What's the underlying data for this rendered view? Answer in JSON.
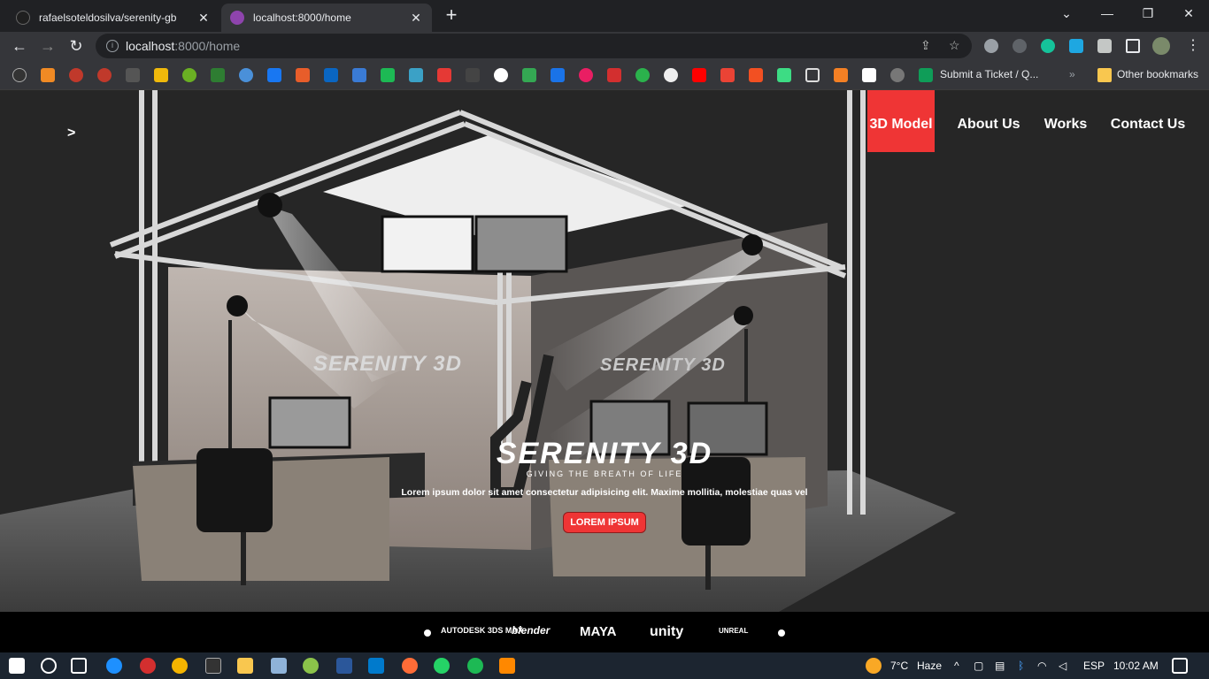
{
  "browser": {
    "tabs": [
      {
        "title": "rafaelsoteldosilva/serenity-gb",
        "close": "✕"
      },
      {
        "title": "localhost:8000/home",
        "close": "✕"
      }
    ],
    "new_tab": "+",
    "window_controls": {
      "dropdown": "⌄",
      "minimize": "—",
      "restore": "❐",
      "close": "✕"
    },
    "nav": {
      "back": "←",
      "forward": "→",
      "reload": "↻"
    },
    "url_host": "localhost",
    "url_rest": ":8000/home",
    "bookmarks_label": "Submit a Ticket / Q...",
    "bookmarks_more": "»",
    "other_bookmarks": "Other bookmarks"
  },
  "site": {
    "menu_toggle": ">",
    "nav": [
      "3D Model",
      "About Us",
      "Works",
      "Contact Us"
    ],
    "hero": {
      "logo": "SERENITY 3D",
      "tagline": "GIVING THE BREATH OF LIFE",
      "text": "Lorem ipsum dolor sit amet consectetur adipisicing elit. Maxime mollitia, molestiae quas vel",
      "button": "LOREM IPSUM"
    },
    "wall_signs": [
      "SERENITY 3D",
      "SERENITY 3D"
    ],
    "software_logos": [
      "AUTODESK 3DS MAX",
      "blender",
      "MAYA",
      "unity",
      "UNREAL"
    ]
  },
  "taskbar": {
    "weather_temp": "7°C",
    "weather_desc": "Haze",
    "language": "ESP",
    "time": "10:02 AM"
  },
  "colors": {
    "accent": "#ef3535",
    "chrome_bg": "#35363a",
    "page_bg": "#262626"
  }
}
